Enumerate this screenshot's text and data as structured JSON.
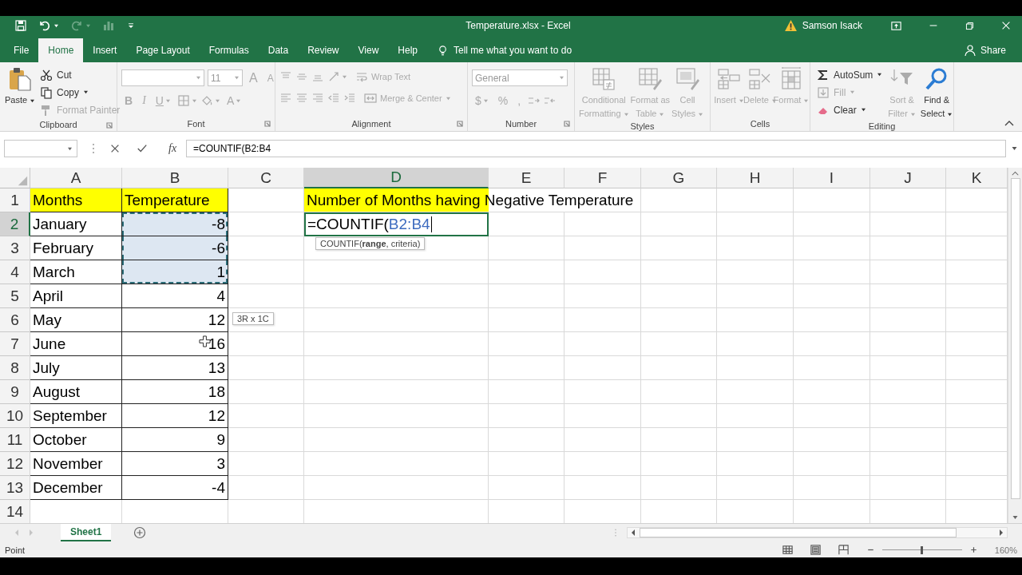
{
  "title_bar": {
    "title": "Temperature.xlsx  -  Excel",
    "user": "Samson Isack"
  },
  "tabs": [
    {
      "label": "File",
      "selected": false
    },
    {
      "label": "Home",
      "selected": true
    },
    {
      "label": "Insert",
      "selected": false
    },
    {
      "label": "Page Layout",
      "selected": false
    },
    {
      "label": "Formulas",
      "selected": false
    },
    {
      "label": "Data",
      "selected": false
    },
    {
      "label": "Review",
      "selected": false
    },
    {
      "label": "View",
      "selected": false
    },
    {
      "label": "Help",
      "selected": false
    }
  ],
  "tell_me": "Tell me what you want to do",
  "share": "Share",
  "ribbon": [
    {
      "label": "Clipboard",
      "launcher": true,
      "commands": [
        {
          "kind": "large",
          "lines": [
            "Paste"
          ],
          "menu": true,
          "disabled": false
        },
        {
          "kind": "small",
          "label": "Cut",
          "menu": false,
          "disabled": false
        },
        {
          "kind": "small",
          "label": "Copy",
          "menu": true,
          "disabled": false
        },
        {
          "kind": "small",
          "label": "Format Painter",
          "menu": false,
          "disabled": true
        }
      ]
    },
    {
      "label": "Font",
      "launcher": true,
      "top_row": [
        {
          "kind": "field",
          "menu": true,
          "disabled": true
        },
        {
          "kind": "field",
          "value": "11",
          "menu": true,
          "disabled": true
        },
        {
          "kind": "glyph",
          "text": "A",
          "menu": false,
          "disabled": true
        },
        {
          "kind": "glyph",
          "text": "A",
          "menu": false,
          "disabled": true
        }
      ],
      "bottom_row": [
        {
          "kind": "glyph",
          "text": "B",
          "menu": false,
          "disabled": true
        },
        {
          "kind": "glyph",
          "text": "I",
          "menu": false,
          "disabled": true
        },
        {
          "kind": "glyph",
          "text": "U",
          "menu": true,
          "disabled": true
        },
        {
          "kind": "icon",
          "menu": true,
          "disabled": true
        },
        {
          "kind": "icon",
          "menu": true,
          "disabled": true
        },
        {
          "kind": "glyph",
          "text": "A",
          "menu": true,
          "disabled": true
        }
      ]
    },
    {
      "label": "Alignment",
      "launcher": true,
      "top_row": [
        {
          "kind": "icon",
          "menu": false,
          "disabled": true
        },
        {
          "kind": "icon",
          "menu": false,
          "disabled": true
        },
        {
          "kind": "icon",
          "menu": false,
          "disabled": true
        },
        {
          "kind": "icon",
          "menu": true,
          "disabled": true
        },
        {
          "kind": "text",
          "label": "Wrap Text",
          "menu": false,
          "disabled": true
        }
      ],
      "bottom_row": [
        {
          "kind": "icon",
          "menu": false,
          "disabled": true
        },
        {
          "kind": "icon",
          "menu": false,
          "disabled": true
        },
        {
          "kind": "icon",
          "menu": false,
          "disabled": true
        },
        {
          "kind": "icon",
          "menu": false,
          "disabled": true
        },
        {
          "kind": "icon",
          "menu": false,
          "disabled": true
        },
        {
          "kind": "text",
          "label": "Merge & Center",
          "menu": true,
          "disabled": true
        }
      ]
    },
    {
      "label": "Number",
      "launcher": true,
      "top_row": [
        {
          "kind": "field",
          "value": "General",
          "menu": true,
          "disabled": true
        }
      ],
      "bottom_row": [
        {
          "kind": "glyph",
          "text": "$",
          "menu": true,
          "disabled": true
        },
        {
          "kind": "glyph",
          "text": "%",
          "menu": false,
          "disabled": true
        },
        {
          "kind": "glyph",
          "text": ",",
          "menu": false,
          "disabled": true
        },
        {
          "kind": "icon",
          "menu": false,
          "disabled": true
        },
        {
          "kind": "icon",
          "menu": false,
          "disabled": true
        }
      ]
    },
    {
      "label": "Styles",
      "launcher": false,
      "commands": [
        {
          "kind": "large",
          "lines": [
            "Conditional",
            "Formatting"
          ],
          "menu": true,
          "disabled": true
        },
        {
          "kind": "large",
          "lines": [
            "Format as",
            "Table"
          ],
          "menu": true,
          "disabled": true
        },
        {
          "kind": "large",
          "lines": [
            "Cell",
            "Styles"
          ],
          "menu": true,
          "disabled": true
        }
      ]
    },
    {
      "label": "Cells",
      "launcher": false,
      "commands": [
        {
          "kind": "large",
          "lines": [
            "Insert"
          ],
          "menu": true,
          "disabled": true
        },
        {
          "kind": "large",
          "lines": [
            "Delete"
          ],
          "menu": true,
          "disabled": true
        },
        {
          "kind": "large",
          "lines": [
            "Format"
          ],
          "menu": true,
          "disabled": true
        }
      ]
    },
    {
      "label": "Editing",
      "launcher": false,
      "commands": [
        {
          "kind": "small",
          "label": "AutoSum",
          "menu": true,
          "disabled": false
        },
        {
          "kind": "small",
          "label": "Fill",
          "menu": true,
          "disabled": true
        },
        {
          "kind": "small",
          "label": "Clear",
          "menu": true,
          "disabled": false
        },
        {
          "kind": "large",
          "lines": [
            "Sort &",
            "Filter"
          ],
          "menu": true,
          "disabled": true
        },
        {
          "kind": "large",
          "lines": [
            "Find &",
            "Select"
          ],
          "menu": true,
          "disabled": false
        }
      ]
    }
  ],
  "formula_bar": {
    "function_button": "fx",
    "formula": "=COUNTIF(B2:B4"
  },
  "columns": [
    {
      "label": "A",
      "selected": false
    },
    {
      "label": "B",
      "selected": false
    },
    {
      "label": "C",
      "selected": false
    },
    {
      "label": "D",
      "selected": true
    },
    {
      "label": "E",
      "selected": false
    },
    {
      "label": "F",
      "selected": false
    },
    {
      "label": "G",
      "selected": false
    },
    {
      "label": "H",
      "selected": false
    },
    {
      "label": "I",
      "selected": false
    },
    {
      "label": "J",
      "selected": false
    },
    {
      "label": "K",
      "selected": false
    }
  ],
  "rows": [
    {
      "number": "1",
      "selected": false,
      "cells": {
        "A": {
          "value": "Months",
          "kind": "text",
          "highlight": true,
          "bordered": true,
          "in_range": false
        },
        "B": {
          "value": "Temperature",
          "kind": "text",
          "highlight": true,
          "bordered": true,
          "in_range": false
        },
        "D": {
          "value": "Number of Months having Negative Temperature",
          "kind": "text",
          "highlight": true,
          "bordered": false,
          "in_range": false
        }
      }
    },
    {
      "number": "2",
      "selected": true,
      "cells": {
        "A": {
          "value": "January",
          "kind": "text",
          "highlight": false,
          "bordered": true,
          "in_range": false
        },
        "B": {
          "value": "-8",
          "kind": "number",
          "highlight": false,
          "bordered": true,
          "in_range": true
        },
        "D": {
          "kind": "editor",
          "value": "=COUNTIF(",
          "reference": "B2:B4"
        }
      }
    },
    {
      "number": "3",
      "selected": false,
      "cells": {
        "A": {
          "value": "February",
          "kind": "text",
          "highlight": false,
          "bordered": true,
          "in_range": false
        },
        "B": {
          "value": "-6",
          "kind": "number",
          "highlight": false,
          "bordered": true,
          "in_range": true
        }
      }
    },
    {
      "number": "4",
      "selected": false,
      "cells": {
        "A": {
          "value": "March",
          "kind": "text",
          "highlight": false,
          "bordered": true,
          "in_range": false
        },
        "B": {
          "value": "1",
          "kind": "number",
          "highlight": false,
          "bordered": true,
          "in_range": true
        }
      }
    },
    {
      "number": "5",
      "selected": false,
      "cells": {
        "A": {
          "value": "April",
          "kind": "text",
          "highlight": false,
          "bordered": true,
          "in_range": false
        },
        "B": {
          "value": "4",
          "kind": "number",
          "highlight": false,
          "bordered": true,
          "in_range": false
        }
      }
    },
    {
      "number": "6",
      "selected": false,
      "cells": {
        "A": {
          "value": "May",
          "kind": "text",
          "highlight": false,
          "bordered": true,
          "in_range": false
        },
        "B": {
          "value": "12",
          "kind": "number",
          "highlight": false,
          "bordered": true,
          "in_range": false
        }
      }
    },
    {
      "number": "7",
      "selected": false,
      "cells": {
        "A": {
          "value": "June",
          "kind": "text",
          "highlight": false,
          "bordered": true,
          "in_range": false
        },
        "B": {
          "value": "16",
          "kind": "number",
          "highlight": false,
          "bordered": true,
          "in_range": false
        }
      }
    },
    {
      "number": "8",
      "selected": false,
      "cells": {
        "A": {
          "value": "July",
          "kind": "text",
          "highlight": false,
          "bordered": true,
          "in_range": false
        },
        "B": {
          "value": "13",
          "kind": "number",
          "highlight": false,
          "bordered": true,
          "in_range": false
        }
      }
    },
    {
      "number": "9",
      "selected": false,
      "cells": {
        "A": {
          "value": "August",
          "kind": "text",
          "highlight": false,
          "bordered": true,
          "in_range": false
        },
        "B": {
          "value": "18",
          "kind": "number",
          "highlight": false,
          "bordered": true,
          "in_range": false
        }
      }
    },
    {
      "number": "10",
      "selected": false,
      "cells": {
        "A": {
          "value": "September",
          "kind": "text",
          "highlight": false,
          "bordered": true,
          "in_range": false
        },
        "B": {
          "value": "12",
          "kind": "number",
          "highlight": false,
          "bordered": true,
          "in_range": false
        }
      }
    },
    {
      "number": "11",
      "selected": false,
      "cells": {
        "A": {
          "value": "October",
          "kind": "text",
          "highlight": false,
          "bordered": true,
          "in_range": false
        },
        "B": {
          "value": "9",
          "kind": "number",
          "highlight": false,
          "bordered": true,
          "in_range": false
        }
      }
    },
    {
      "number": "12",
      "selected": false,
      "cells": {
        "A": {
          "value": "November",
          "kind": "text",
          "highlight": false,
          "bordered": true,
          "in_range": false
        },
        "B": {
          "value": "3",
          "kind": "number",
          "highlight": false,
          "bordered": true,
          "in_range": false
        }
      }
    },
    {
      "number": "13",
      "selected": false,
      "cells": {
        "A": {
          "value": "December",
          "kind": "text",
          "highlight": false,
          "bordered": true,
          "in_range": false
        },
        "B": {
          "value": "-4",
          "kind": "number",
          "highlight": false,
          "bordered": true,
          "in_range": false
        }
      }
    },
    {
      "number": "14",
      "selected": false
    }
  ],
  "function_tooltip": "COUNTIF(**range**, criteria)",
  "range_size_tooltip": "3R x 1C",
  "sheets": [
    {
      "label": "Sheet1",
      "selected": true
    }
  ],
  "status_bar": {
    "mode": "Point",
    "zoom": {
      "level": 0.5,
      "reading": "160%"
    }
  }
}
